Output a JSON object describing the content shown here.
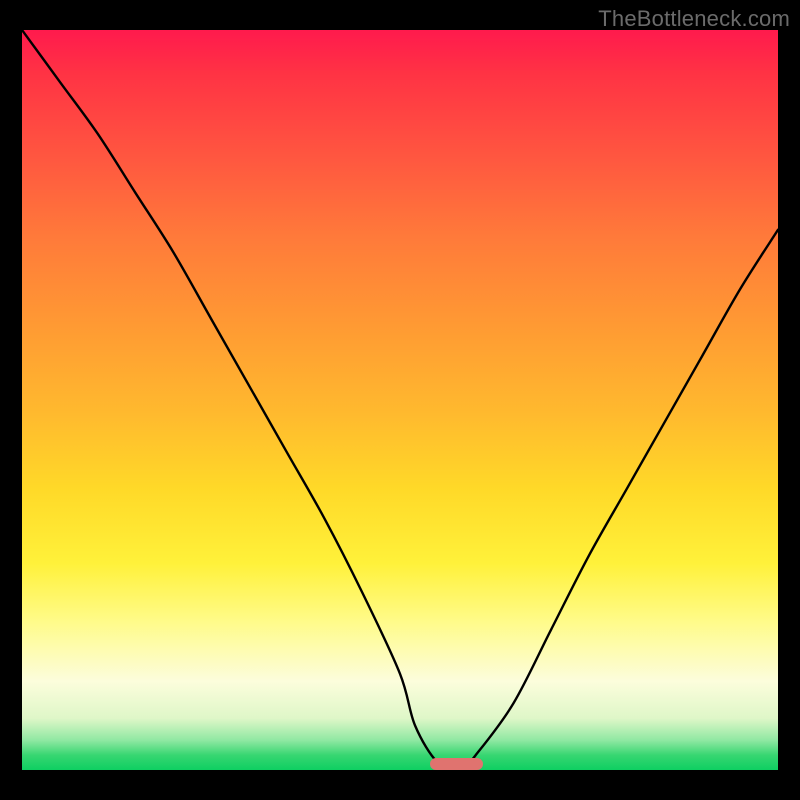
{
  "watermark": "TheBottleneck.com",
  "colors": {
    "page_bg": "#000000",
    "watermark": "#6b6b6b",
    "curve_stroke": "#000000",
    "marker_fill": "#e0736f",
    "gradient_stops": [
      "#ff1a4d",
      "#ff3344",
      "#ff5640",
      "#ff7a3a",
      "#ff9a33",
      "#ffba2e",
      "#ffd928",
      "#fff13a",
      "#fffb8a",
      "#fcfddc",
      "#dff7c8",
      "#8fe8a2",
      "#37d671",
      "#0ecf62"
    ]
  },
  "chart_data": {
    "type": "line",
    "title": "",
    "xlabel": "",
    "ylabel": "",
    "xlim": [
      0,
      100
    ],
    "ylim": [
      0,
      100
    ],
    "grid": false,
    "series": [
      {
        "name": "bottleneck-curve",
        "x": [
          0,
          5,
          10,
          15,
          20,
          25,
          30,
          35,
          40,
          45,
          50,
          52,
          55,
          58,
          60,
          65,
          70,
          75,
          80,
          85,
          90,
          95,
          100
        ],
        "y": [
          100,
          93,
          86,
          78,
          70,
          61,
          52,
          43,
          34,
          24,
          13,
          6,
          1,
          0,
          2,
          9,
          19,
          29,
          38,
          47,
          56,
          65,
          73
        ]
      }
    ],
    "marker": {
      "x_range": [
        54,
        61
      ],
      "y": 0,
      "label": ""
    },
    "background": {
      "kind": "vertical-gradient",
      "meaning": "top=high-bottleneck (red), bottom=low-bottleneck (green)"
    }
  }
}
